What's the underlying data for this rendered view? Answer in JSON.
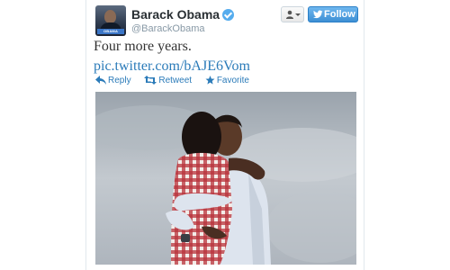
{
  "profile": {
    "name": "Barack Obama",
    "handle": "@BarackObama",
    "avatar_caption": "OBAMA",
    "verified": true
  },
  "buttons": {
    "follow_label": "Follow"
  },
  "tweet": {
    "text": "Four more years.",
    "link_text": "pic.twitter.com/bAJE6Vom"
  },
  "actions": {
    "reply_label": "Reply",
    "retweet_label": "Retweet",
    "favorite_label": "Favorite"
  },
  "icons": {
    "verified": "verified-badge-icon",
    "user_menu": "person-icon",
    "follow": "twitter-bird-icon",
    "reply": "reply-arrow-icon",
    "retweet": "retweet-icon",
    "favorite": "star-icon"
  },
  "colors": {
    "link": "#2b7bb9",
    "follow_button": "#55acee",
    "text": "#333333",
    "muted": "#8899a6"
  }
}
